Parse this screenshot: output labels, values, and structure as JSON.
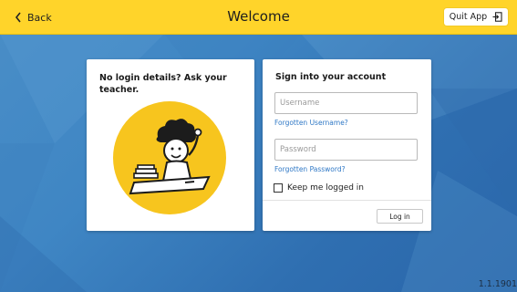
{
  "header": {
    "back_label": "Back",
    "title": "Welcome",
    "quit_label": "Quit App"
  },
  "left_card": {
    "heading": "No login details? Ask your teacher."
  },
  "login_form": {
    "heading": "Sign into your account",
    "username_placeholder": "Username",
    "username_value": "",
    "forgot_username": "Forgotten Username?",
    "password_placeholder": "Password",
    "password_value": "",
    "forgot_password": "Forgotten Password?",
    "keep_logged_in": "Keep me logged in",
    "keep_logged_in_checked": false,
    "login_button": "Log in"
  },
  "footer": {
    "version": "1.1.1901"
  },
  "colors": {
    "topbar": "#ffd42a",
    "background": "#3f86c4",
    "illustration_circle": "#f7c51e",
    "link": "#2f78c6"
  },
  "icons": {
    "back": "chevron-left-icon",
    "quit": "exit-door-icon"
  }
}
